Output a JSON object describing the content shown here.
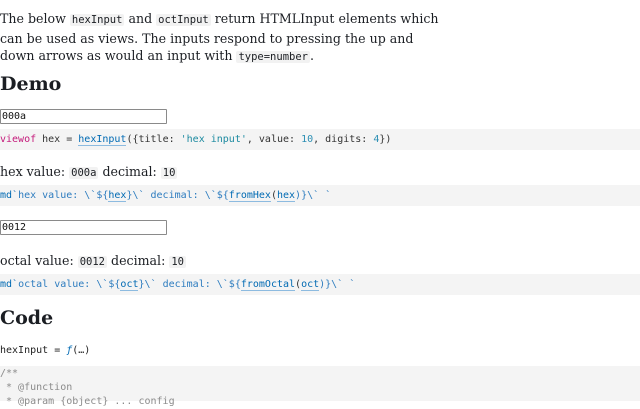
{
  "intro": {
    "t1": "The below ",
    "c1": "hexInput",
    "t2": " and ",
    "c2": "octInput",
    "t3": " return HTMLInput elements which can be used as views. The inputs respond to pressing the up and down arrows as would an input with ",
    "c3": "type=number",
    "t4": "."
  },
  "demo_heading": "Demo",
  "hex_input": {
    "value": "000a"
  },
  "hex_cell": {
    "kw": "viewof",
    "sp1": " hex = ",
    "fn": "hexInput",
    "p1": "({title: ",
    "title": "'hex input'",
    "p2": ", value: ",
    "value": "10",
    "p3": ", digits: ",
    "digits": "4",
    "p4": "})"
  },
  "hex_output": {
    "label": "hex value: ",
    "hex": "000a",
    "mid": " decimal: ",
    "dec": "10"
  },
  "hex_md": {
    "tag": "md",
    "s1": "`hex value: \\`${",
    "v1": "hex",
    "s2": "}\\` decimal: \\`${",
    "f": "fromHex",
    "p": "(",
    "v2": "hex",
    "s3": ")}\\` `"
  },
  "oct_input": {
    "value": "0012"
  },
  "oct_output": {
    "label": "octal value: ",
    "oct": "0012",
    "mid": " decimal: ",
    "dec": "10"
  },
  "oct_md": {
    "tag": "md",
    "s1": "`octal value: \\`${",
    "v1": "oct",
    "s2": "}\\` decimal: \\`${",
    "f": "fromOctal",
    "p": "(",
    "v2": "oct",
    "s3": ")}\\` `"
  },
  "code_heading": "Code",
  "hexinput_def": {
    "name": "hexInput",
    "eq": " = ",
    "f": "ƒ",
    "rest": "(…)"
  },
  "code_block": {
    "l1": "/**",
    "l2": " * @function",
    "l3": " * @param {object} ... config"
  }
}
